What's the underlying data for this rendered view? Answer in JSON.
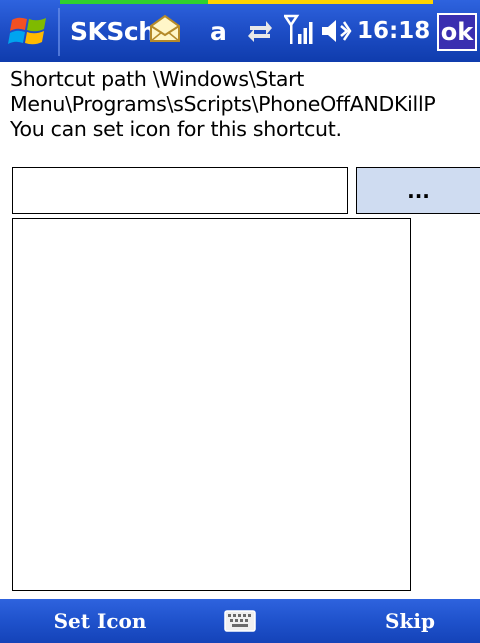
{
  "titlebar": {
    "app_title": "SKSche",
    "app_title_tail": "a",
    "clock": "16:18",
    "ok_label": "ok",
    "icons": {
      "start": "windows-flag-icon",
      "notification": "mail-notification-icon",
      "connectivity": "sync-arrows-icon",
      "signal": "signal-strength-icon",
      "volume": "speaker-icon"
    },
    "colors": {
      "bar": "#1f4fc8",
      "ok_background": "#3a2fb0",
      "strip_green": "#2fd12f",
      "strip_yellow": "#ffd400"
    }
  },
  "content": {
    "description_lines": [
      "Shortcut path \\Windows\\Start",
      "Menu\\Programs\\sScripts\\PhoneOffANDKillP",
      "You can set icon for this shortcut."
    ],
    "icon_path_input": {
      "value": "",
      "placeholder": ""
    },
    "browse_label": "...",
    "browse_color": "#cfdcf1"
  },
  "menubar": {
    "left_softkey": "Set Icon",
    "right_softkey": "Skip",
    "keyboard_icon": "keyboard-icon"
  }
}
